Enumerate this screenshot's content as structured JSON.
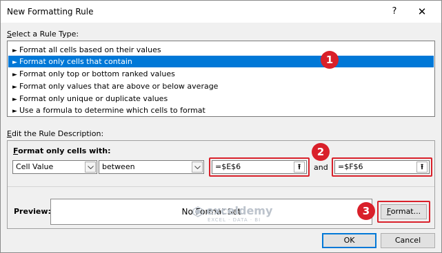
{
  "dialog": {
    "title": "New Formatting Rule",
    "help_glyph": "?",
    "close_glyph": "✕"
  },
  "rule_type": {
    "label_u": "S",
    "label_rest": "elect a Rule Type:",
    "items": [
      {
        "label": "Format all cells based on their values"
      },
      {
        "label": "Format only cells that contain"
      },
      {
        "label": "Format only top or bottom ranked values"
      },
      {
        "label": "Format only values that are above or below average"
      },
      {
        "label": "Format only unique or duplicate values"
      },
      {
        "label": "Use a formula to determine which cells to format"
      }
    ],
    "selected_index": 1
  },
  "description": {
    "label_u": "E",
    "label_rest": "dit the Rule Description:",
    "format_only_label_u": "F",
    "format_only_label_rest": "ormat only cells with:",
    "condition_select": "Cell Value",
    "operator_select": "between",
    "value1": "=$E$6",
    "and_label": "and",
    "value2": "=$F$6",
    "ref_glyph": "⭱"
  },
  "preview": {
    "label": "Preview:",
    "text": "No Format Set",
    "format_button_u": "F",
    "format_button_rest": "ormat..."
  },
  "buttons": {
    "ok": "OK",
    "cancel": "Cancel"
  },
  "badges": [
    "1",
    "2",
    "3"
  ],
  "watermark": {
    "name": "exceldemy",
    "sub": "EXCEL · DATA · BI"
  },
  "colors": {
    "selection": "#0078d7",
    "highlight": "#d9202a"
  }
}
